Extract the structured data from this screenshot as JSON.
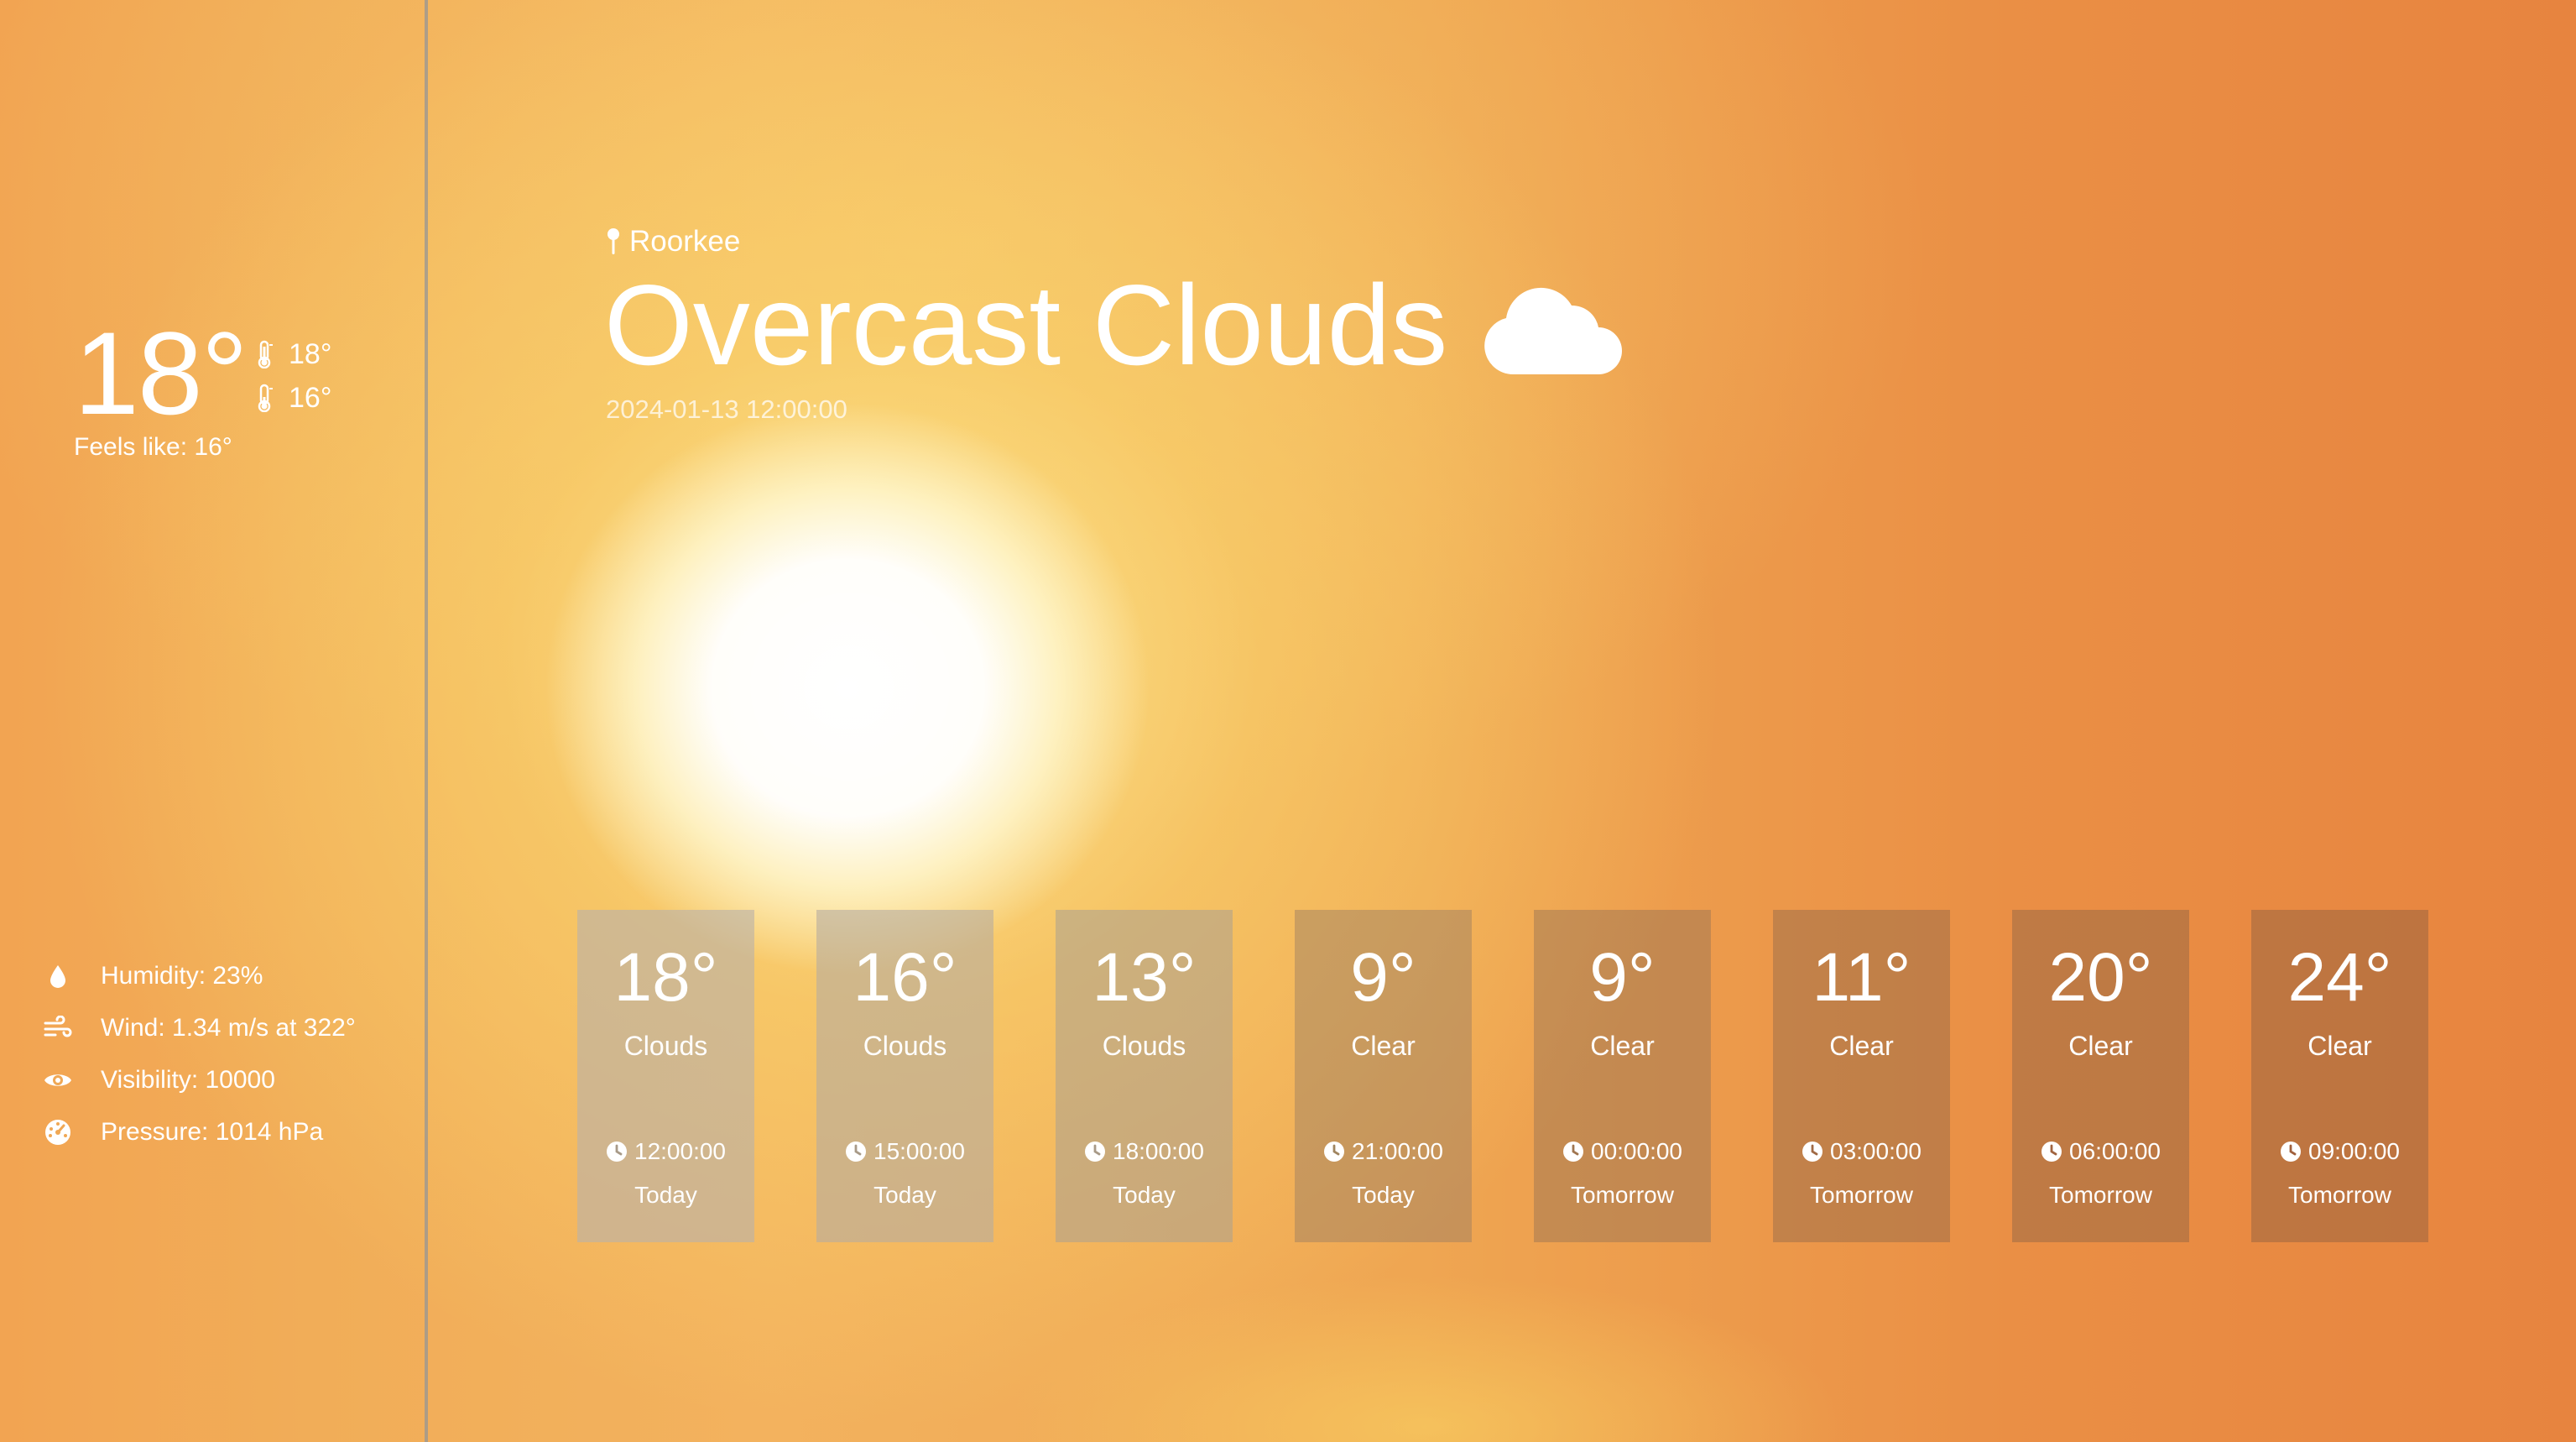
{
  "current": {
    "temperature": "18°",
    "max_temp": "18°",
    "min_temp": "16°",
    "feels_like": "Feels like: 16°"
  },
  "details": [
    {
      "icon": "droplet-icon",
      "text": "Humidity: 23%"
    },
    {
      "icon": "wind-icon",
      "text": "Wind: 1.34 m/s at 322°"
    },
    {
      "icon": "eye-icon",
      "text": "Visibility: 10000"
    },
    {
      "icon": "gauge-icon",
      "text": "Pressure: 1014 hPa"
    }
  ],
  "location": "Roorkee",
  "condition": "Overcast Clouds",
  "condition_icon": "cloud-icon",
  "datetime": "2024-01-13 12:00:00",
  "forecast": [
    {
      "temp": "18°",
      "desc": "Clouds",
      "time": "12:00:00",
      "day": "Today"
    },
    {
      "temp": "16°",
      "desc": "Clouds",
      "time": "15:00:00",
      "day": "Today"
    },
    {
      "temp": "13°",
      "desc": "Clouds",
      "time": "18:00:00",
      "day": "Today"
    },
    {
      "temp": "9°",
      "desc": "Clear",
      "time": "21:00:00",
      "day": "Today"
    },
    {
      "temp": "9°",
      "desc": "Clear",
      "time": "00:00:00",
      "day": "Tomorrow"
    },
    {
      "temp": "11°",
      "desc": "Clear",
      "time": "03:00:00",
      "day": "Tomorrow"
    },
    {
      "temp": "20°",
      "desc": "Clear",
      "time": "06:00:00",
      "day": "Tomorrow"
    },
    {
      "temp": "24°",
      "desc": "Clear",
      "time": "09:00:00",
      "day": "Tomorrow"
    }
  ],
  "colors": {
    "card_bg": "#8e7862",
    "sidebar_divider": "#969696",
    "text": "#ffffff"
  }
}
